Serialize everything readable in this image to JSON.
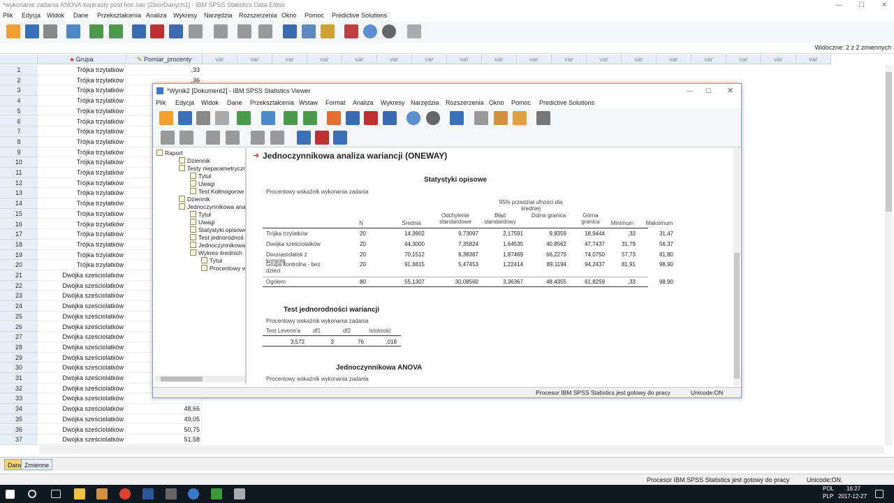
{
  "main_window": {
    "title": "*wykonanie zadania ANOVA kontrasty post hoc.sav [ZbiorDanych1] - IBM SPSS Statistics Data Editor",
    "menu": [
      "Plik",
      "Edycja",
      "Widok",
      "Dane",
      "Przekształcenia",
      "Analiza",
      "Wykresy",
      "Narzędzia",
      "Rozszerzenia",
      "Okno",
      "Pomoc",
      "Predictive Solutions"
    ],
    "visible_vars": "Widoczne: 2 z 2 zmiennych"
  },
  "grid": {
    "col_grupa": "Grupa",
    "col_pomiar": "Pomiar_procenty",
    "var_label": "var",
    "rows": [
      {
        "n": "1",
        "g": "Trójka trzylatków",
        "p": ",33"
      },
      {
        "n": "2",
        "g": "Trójka trzylatków",
        "p": ",36"
      },
      {
        "n": "3",
        "g": "Trójka trzylatków",
        "p": ""
      },
      {
        "n": "4",
        "g": "Trójka trzylatków",
        "p": ""
      },
      {
        "n": "5",
        "g": "Trójka trzylatków",
        "p": ""
      },
      {
        "n": "6",
        "g": "Trójka trzylatków",
        "p": ""
      },
      {
        "n": "7",
        "g": "Trójka trzylatków",
        "p": ""
      },
      {
        "n": "8",
        "g": "Trójka trzylatków",
        "p": ""
      },
      {
        "n": "9",
        "g": "Trójka trzylatków",
        "p": ""
      },
      {
        "n": "10",
        "g": "Trójka trzylatków",
        "p": ""
      },
      {
        "n": "11",
        "g": "Trójka trzylatków",
        "p": ""
      },
      {
        "n": "12",
        "g": "Trójka trzylatków",
        "p": ""
      },
      {
        "n": "13",
        "g": "Trójka trzylatków",
        "p": ""
      },
      {
        "n": "14",
        "g": "Trójka trzylatków",
        "p": ""
      },
      {
        "n": "15",
        "g": "Trójka trzylatków",
        "p": ""
      },
      {
        "n": "16",
        "g": "Trójka trzylatków",
        "p": ""
      },
      {
        "n": "17",
        "g": "Trójka trzylatków",
        "p": ""
      },
      {
        "n": "18",
        "g": "Trójka trzylatków",
        "p": ""
      },
      {
        "n": "19",
        "g": "Trójka trzylatków",
        "p": ""
      },
      {
        "n": "20",
        "g": "Trójka trzylatków",
        "p": ""
      },
      {
        "n": "21",
        "g": "Dwójka sześciolatków",
        "p": ""
      },
      {
        "n": "22",
        "g": "Dwójka sześciolatków",
        "p": ""
      },
      {
        "n": "23",
        "g": "Dwójka sześciolatków",
        "p": ""
      },
      {
        "n": "24",
        "g": "Dwójka sześciolatków",
        "p": ""
      },
      {
        "n": "25",
        "g": "Dwójka sześciolatków",
        "p": ""
      },
      {
        "n": "26",
        "g": "Dwójka sześciolatków",
        "p": ""
      },
      {
        "n": "27",
        "g": "Dwójka sześciolatków",
        "p": ""
      },
      {
        "n": "28",
        "g": "Dwójka sześciolatków",
        "p": ""
      },
      {
        "n": "29",
        "g": "Dwójka sześciolatków",
        "p": ""
      },
      {
        "n": "30",
        "g": "Dwójka sześciolatków",
        "p": ""
      },
      {
        "n": "31",
        "g": "Dwójka sześciolatków",
        "p": ""
      },
      {
        "n": "32",
        "g": "Dwójka sześciolatków",
        "p": ""
      },
      {
        "n": "33",
        "g": "Dwójka sześciolatków",
        "p": ""
      },
      {
        "n": "34",
        "g": "Dwójka sześciolatków",
        "p": "48,66"
      },
      {
        "n": "35",
        "g": "Dwójka sześciolatków",
        "p": "49,05"
      },
      {
        "n": "36",
        "g": "Dwójka sześciolatków",
        "p": "50,75"
      },
      {
        "n": "37",
        "g": "Dwójka sześciolatków",
        "p": "51,58"
      }
    ]
  },
  "tabs": {
    "dane": "Dane",
    "zmienne": "Zmienne"
  },
  "status": {
    "processor": "Procesor IBM SPSS Statistics  jest gotowy do pracy",
    "unicode": "Unicode:ON"
  },
  "taskbar": {
    "lang": "POL",
    "layout": "PLP",
    "time": "16:27",
    "date": "2017-12-27"
  },
  "viewer": {
    "title": "*Wynik2 [Dokument2] - IBM SPSS Statistics Viewer",
    "menu": [
      "Plik",
      "Edycja",
      "Widok",
      "Dane",
      "Przekształcenia",
      "Wstaw",
      "Format",
      "Analiza",
      "Wykresy",
      "Narzędzia",
      "Rozszerzenia",
      "Okno",
      "Pomoc",
      "Predictive Solutions"
    ],
    "tree": [
      "Raport",
      "Dziennik",
      "Testy nieparametryczn",
      "Tytuł",
      "Uwagi",
      "Test Kołmogorow",
      "Dziennik",
      "Jednoczynnikowa anal",
      "Tytuł",
      "Uwagi",
      "Statystyki opisowe",
      "Test jednorodnoś",
      "Jednoczynnikowa",
      "Wykres średnich",
      "Tytuł",
      "Procentowy w"
    ],
    "heading": "Jednoczynnikowa analiza wariancji (ONEWAY)",
    "desc_title": "Statystyki opisowe",
    "var_label": "Procentowy wskaźnik wykonania zadania",
    "ci_header": "95% przedział ufności dla średniej",
    "desc_cols": [
      "N",
      "Średnia",
      "Odchylenie standardowe",
      "Błąd standardowy",
      "Dolna granica",
      "Górna granica",
      "Minimum",
      "Maksimum"
    ],
    "desc_rows": [
      [
        "Trójka trzylatków",
        "20",
        "14,3902",
        "9,73097",
        "2,17591",
        "9,8359",
        "18,9444",
        ",33",
        "31,47"
      ],
      [
        "Dwójka sześciolatków",
        "20",
        "44,3000",
        "7,35824",
        "1,64535",
        "40,8562",
        "47,7437",
        "31,79",
        "56,37"
      ],
      [
        "Dwunastolatek z konsolą",
        "20",
        "70,1512",
        "8,38387",
        "1,87469",
        "66,2275",
        "74,0750",
        "57,73",
        "81,80"
      ],
      [
        "Grupa kontrolna - bez dzieci",
        "20",
        "91,6815",
        "5,47453",
        "1,22414",
        "89,1194",
        "94,2437",
        "81,91",
        "98,90"
      ],
      [
        "Ogółem",
        "80",
        "55,1307",
        "30,08560",
        "3,36367",
        "48,4355",
        "61,8259",
        ",33",
        "98,90"
      ]
    ],
    "lev_title": "Test jednorodności wariancji",
    "lev_cols": [
      "Test Levene'a",
      "df1",
      "df2",
      "Istotność"
    ],
    "lev_row": [
      "3,572",
      "3",
      "76",
      ",018"
    ],
    "anova_title": "Jednoczynnikowa ANOVA",
    "status_proc": "Procesor IBM SPSS Statistics  jest gotowy do pracy",
    "status_uni": "Unicode:ON"
  }
}
